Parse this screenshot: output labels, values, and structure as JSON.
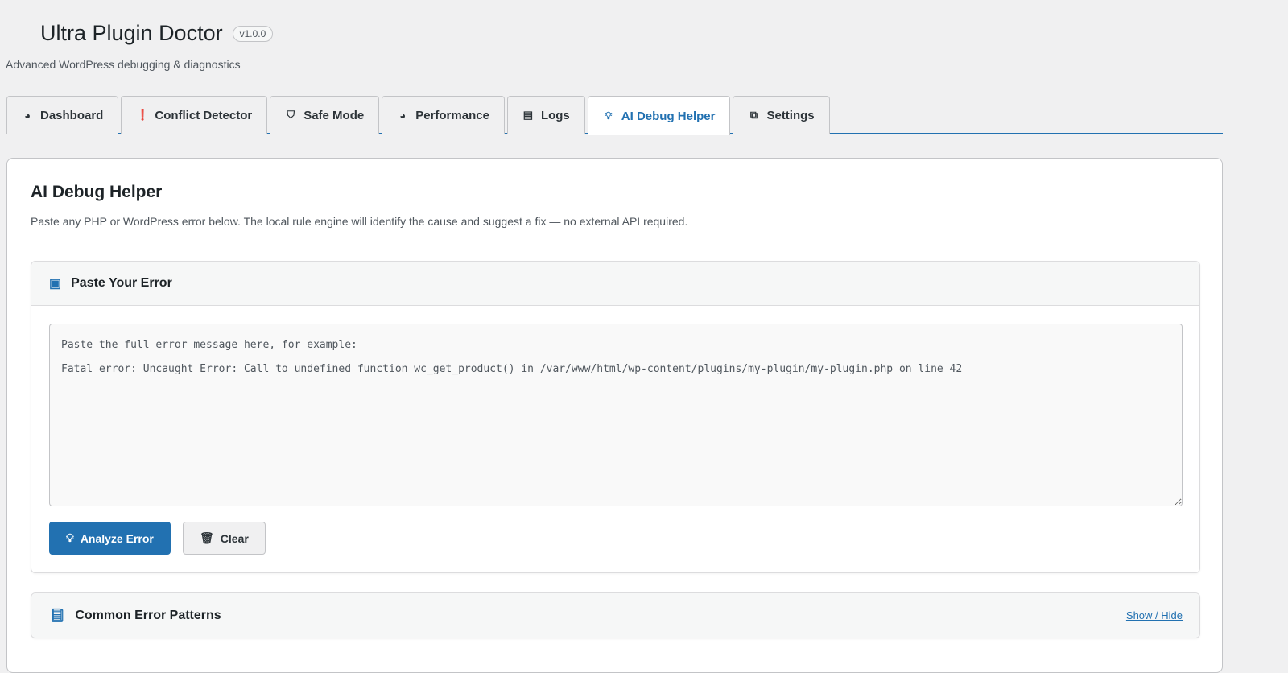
{
  "header": {
    "title": "Ultra Plugin Doctor",
    "version": "v1.0.0",
    "subtitle": "Advanced WordPress debugging & diagnostics"
  },
  "tabs": [
    {
      "label": "Dashboard",
      "icon": "dashboard-icon"
    },
    {
      "label": "Conflict Detector",
      "icon": "exclamation-icon"
    },
    {
      "label": "Safe Mode",
      "icon": "shield-icon"
    },
    {
      "label": "Performance",
      "icon": "gauge-icon"
    },
    {
      "label": "Logs",
      "icon": "document-icon"
    },
    {
      "label": "AI Debug Helper",
      "icon": "lightbulb-icon",
      "active": true
    },
    {
      "label": "Settings",
      "icon": "sliders-icon"
    }
  ],
  "main": {
    "title": "AI Debug Helper",
    "description": "Paste any PHP or WordPress error below. The local rule engine will identify the cause and suggest a fix — no external API required.",
    "paste_panel": {
      "title": "Paste Your Error",
      "value": "",
      "placeholder": "Paste the full error message here, for example:\n\nFatal error: Uncaught Error: Call to undefined function wc_get_product() in /var/www/html/wp-content/plugins/my-plugin/my-plugin.php on line 42",
      "analyze_label": "Analyze Error",
      "clear_label": "Clear"
    },
    "patterns_panel": {
      "title": "Common Error Patterns",
      "toggle_label": "Show / Hide"
    }
  },
  "colors": {
    "accent": "#2271b1"
  }
}
